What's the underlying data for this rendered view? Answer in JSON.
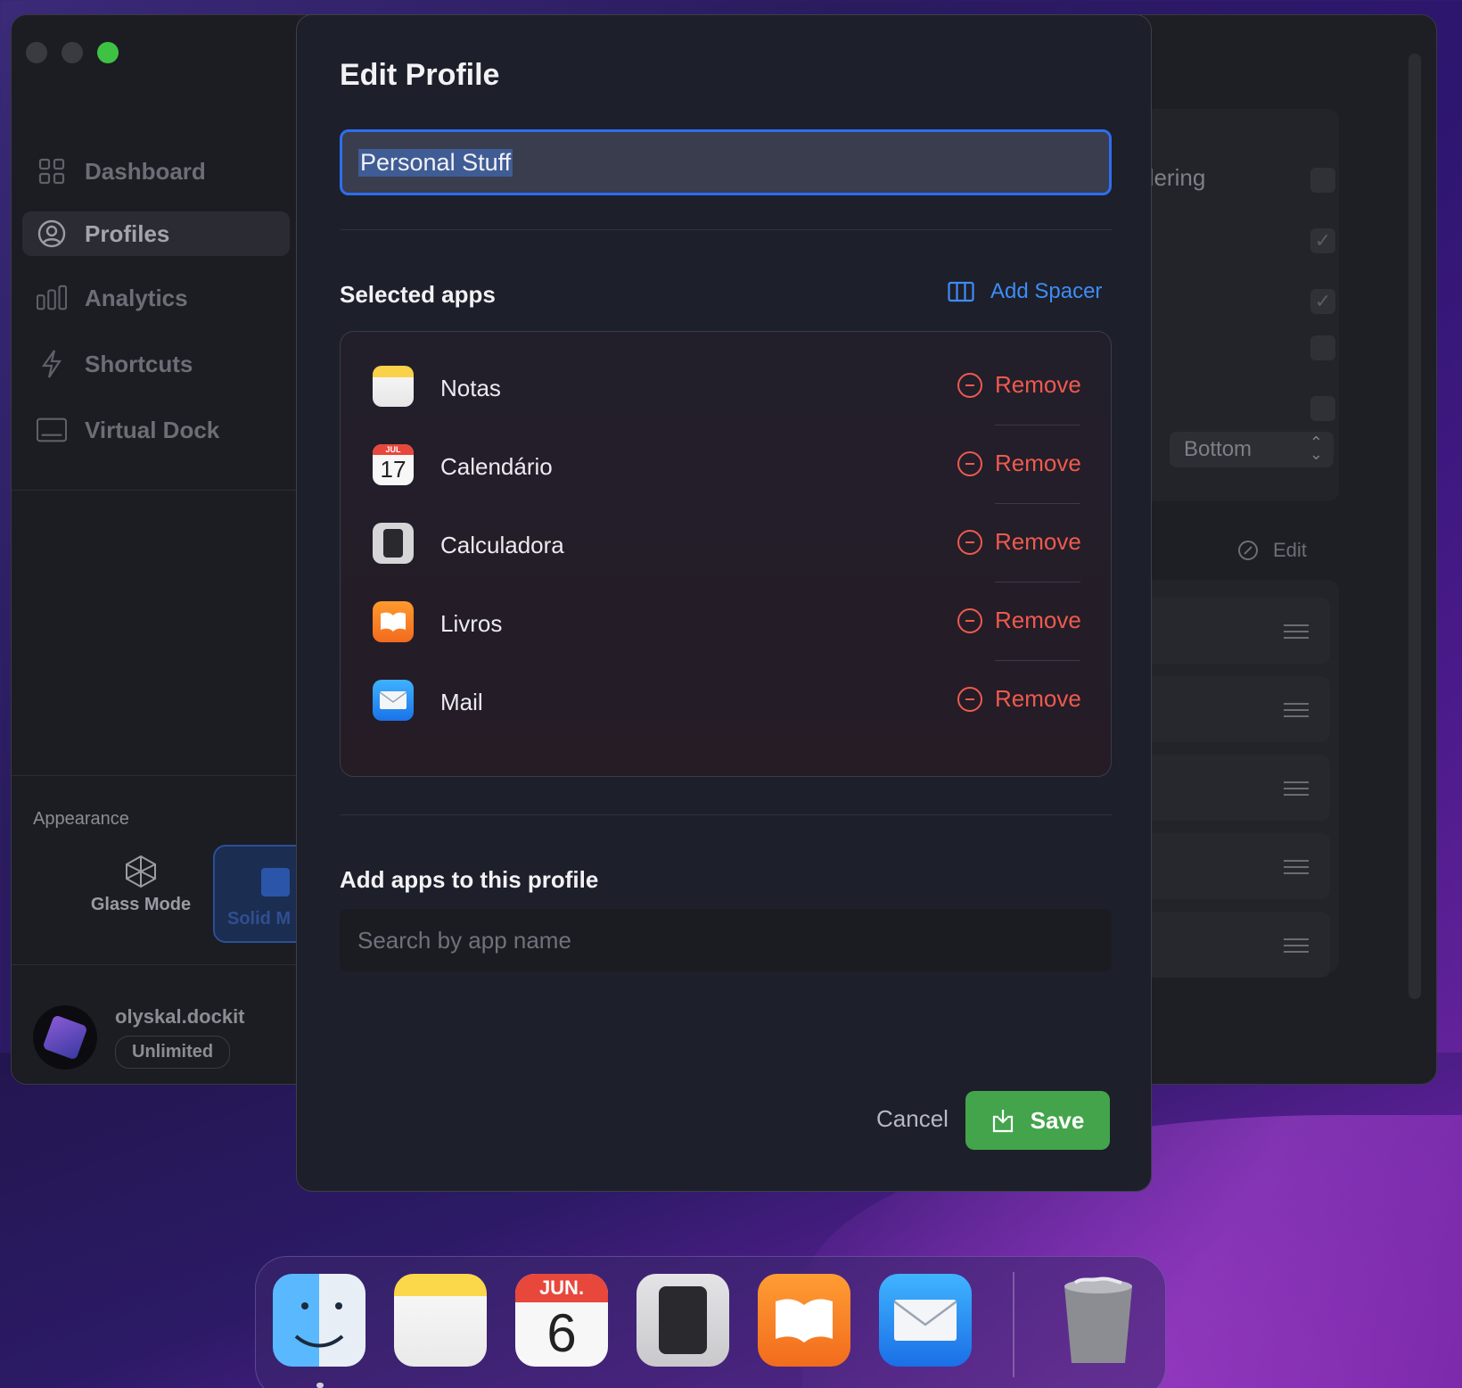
{
  "sidebar": {
    "items": [
      {
        "label": "Dashboard",
        "icon": "grid-icon"
      },
      {
        "label": "Profiles",
        "icon": "person-circle-icon"
      },
      {
        "label": "Analytics",
        "icon": "bar-chart-icon"
      },
      {
        "label": "Shortcuts",
        "icon": "bolt-icon"
      },
      {
        "label": "Virtual Dock",
        "icon": "dock-icon"
      }
    ],
    "appearance_label": "Appearance",
    "glass_mode": "Glass Mode",
    "solid_mode": "Solid M",
    "username": "olyskal.dockit",
    "plan": "Unlimited"
  },
  "background_panel": {
    "ordering_text": "dering",
    "position_select": "Bottom",
    "edit_label": "Edit"
  },
  "modal": {
    "title": "Edit Profile",
    "name_value": "Personal Stuff",
    "selected_apps_title": "Selected apps",
    "add_spacer_label": "Add Spacer",
    "apps": [
      {
        "name": "Notas",
        "icon": "notes-icon",
        "remove_label": "Remove"
      },
      {
        "name": "Calendário",
        "icon": "calendar-icon",
        "remove_label": "Remove"
      },
      {
        "name": "Calculadora",
        "icon": "calculator-icon",
        "remove_label": "Remove"
      },
      {
        "name": "Livros",
        "icon": "books-icon",
        "remove_label": "Remove"
      },
      {
        "name": "Mail",
        "icon": "mail-icon",
        "remove_label": "Remove"
      }
    ],
    "calendar_icon_month": "JUL",
    "calendar_icon_day": "17",
    "add_apps_title": "Add apps to this profile",
    "search_placeholder": "Search by app name",
    "cancel_label": "Cancel",
    "save_label": "Save"
  },
  "dock": {
    "calendar_month": "JUN.",
    "calendar_day": "6"
  },
  "colors": {
    "accent_blue": "#2d6ef0",
    "remove_red": "#ee5a4e",
    "save_green": "#43a44c"
  }
}
